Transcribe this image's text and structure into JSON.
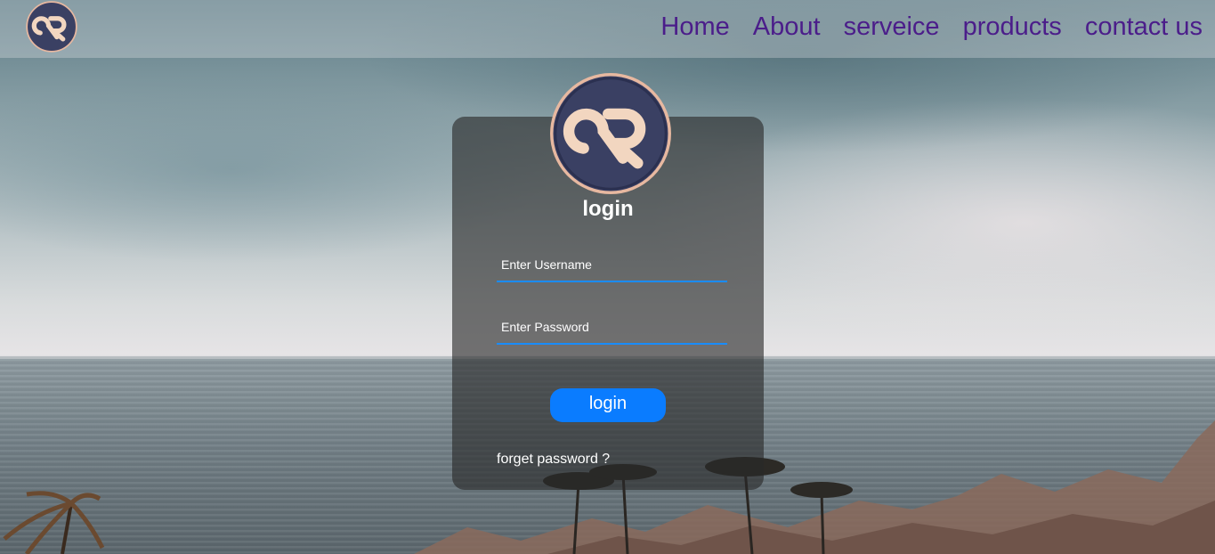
{
  "nav": {
    "links": [
      "Home",
      "About",
      "serveice",
      "products",
      "contact us"
    ],
    "link_color": "#4b1d8a",
    "logo_icon": "dr-monogram-logo"
  },
  "login": {
    "title": "login",
    "username_placeholder": "Enter Username",
    "password_placeholder": "Enter Password",
    "button_label": "login",
    "forget_link": "forget password ?",
    "accent_color": "#0a7cff",
    "logo_icon": "dr-monogram-logo"
  }
}
